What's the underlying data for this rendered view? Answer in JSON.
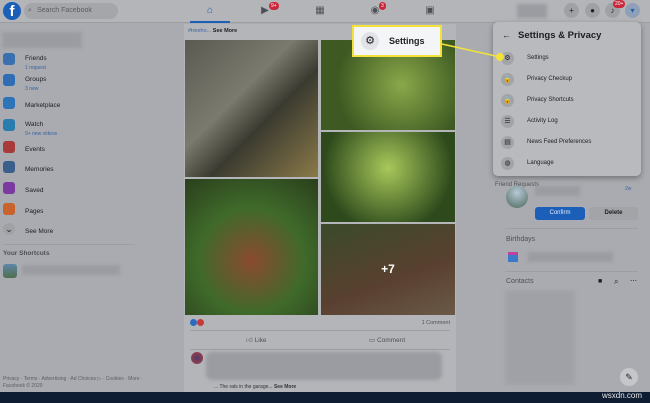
{
  "topbar": {
    "logo": "f",
    "search_placeholder": "Search Facebook",
    "nav": [
      {
        "icon": "home-icon",
        "badge": ""
      },
      {
        "icon": "watch-icon",
        "badge": "9+"
      },
      {
        "icon": "marketplace-icon",
        "badge": ""
      },
      {
        "icon": "groups-icon",
        "badge": "3"
      },
      {
        "icon": "gaming-icon",
        "badge": ""
      }
    ],
    "notifications_badge": "20+"
  },
  "sidebar": {
    "items": [
      {
        "label": "Friends",
        "sub": "1 request",
        "icon": "friends-icon",
        "color": "#3a6fb0"
      },
      {
        "label": "Groups",
        "sub": "3 new",
        "icon": "groups-icon",
        "color": "#2f6db5"
      },
      {
        "label": "Marketplace",
        "sub": "",
        "icon": "marketplace-icon",
        "color": "#2d73b8"
      },
      {
        "label": "Watch",
        "sub": "9+ new videos",
        "icon": "watch-icon",
        "color": "#2b7cae"
      },
      {
        "label": "Events",
        "sub": "",
        "icon": "events-icon",
        "color": "#a83a3a"
      },
      {
        "label": "Memories",
        "sub": "",
        "icon": "memories-icon",
        "color": "#3a5f8a"
      },
      {
        "label": "Saved",
        "sub": "",
        "icon": "saved-icon",
        "color": "#7a3aa0"
      },
      {
        "label": "Pages",
        "sub": "",
        "icon": "pages-icon",
        "color": "#c8632d"
      },
      {
        "label": "See More",
        "sub": "",
        "icon": "chevron-down-icon",
        "color": "#9fa1a5"
      }
    ],
    "shortcuts_heading": "Your Shortcuts",
    "footer": "Privacy · Terms · Advertising · Ad Choices ▷ · Cookies · More · Facebook © 2020"
  },
  "post": {
    "text": "#treeho...",
    "see_more": "See More",
    "more_photos": "+7",
    "comments": "1 Comment",
    "like": "Like",
    "comment": "Comment",
    "next_text": "... The rats in the garage...",
    "next_see_more": "See More"
  },
  "menu": {
    "title": "Settings & Privacy",
    "items": [
      {
        "label": "Settings",
        "icon": "gear-icon",
        "glyph": "⚙"
      },
      {
        "label": "Privacy Checkup",
        "icon": "lock-icon",
        "glyph": "🔒"
      },
      {
        "label": "Privacy Shortcuts",
        "icon": "lock-icon",
        "glyph": "🔒"
      },
      {
        "label": "Activity Log",
        "icon": "list-icon",
        "glyph": "☰"
      },
      {
        "label": "News Feed Preferences",
        "icon": "news-feed-icon",
        "glyph": "▤"
      },
      {
        "label": "Language",
        "icon": "globe-icon",
        "glyph": "◍"
      }
    ]
  },
  "callout": {
    "label": "Settings"
  },
  "right": {
    "friend_requests": "Friend Requests",
    "time": "2w",
    "confirm": "Confirm",
    "delete": "Delete",
    "birthdays": "Birthdays",
    "contacts": "Contacts"
  },
  "colors": {
    "accent": "#1b5fb8",
    "highlight": "#f3e23a"
  },
  "watermark": "wsxdn.com"
}
